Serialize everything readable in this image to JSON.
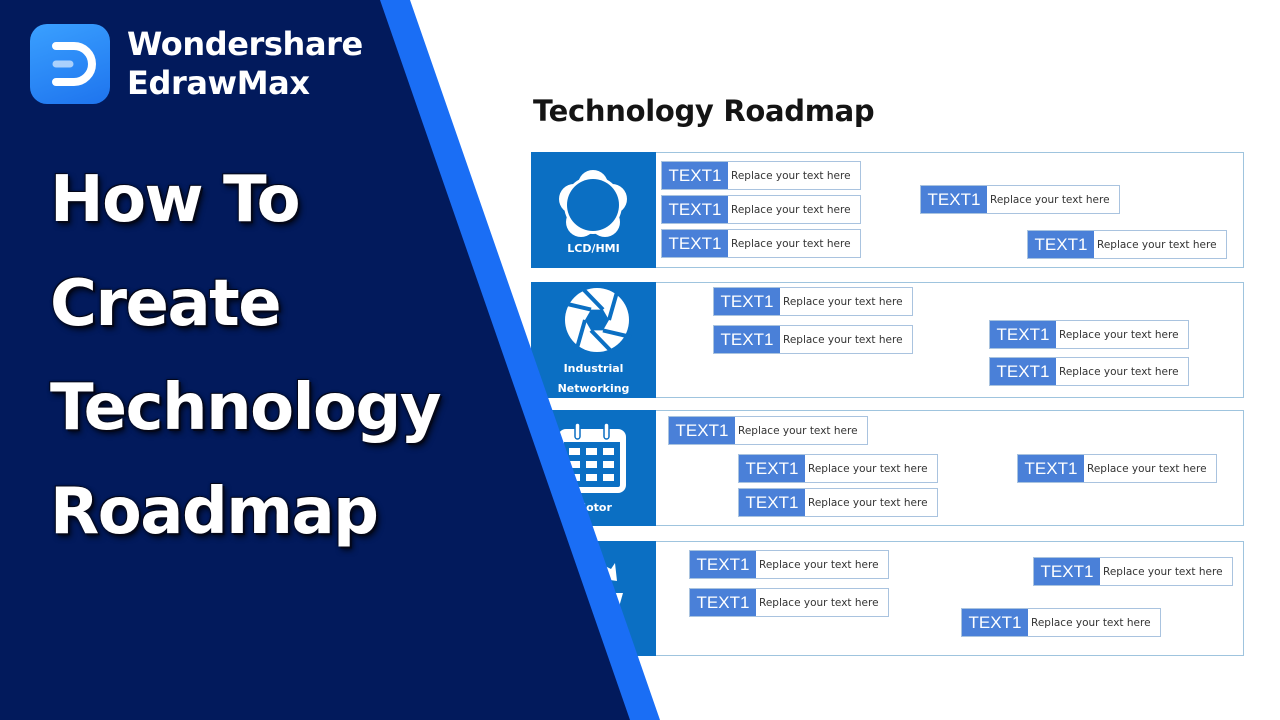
{
  "brand": {
    "name_line1": "Wondershare",
    "name_line2": "EdrawMax",
    "logo_icon": "edrawmax-logo-icon"
  },
  "headline": {
    "lines": [
      "How To",
      "Create",
      "Technology",
      "Roadmap"
    ]
  },
  "colors": {
    "navy_panel": "#021a5c",
    "accent_stripe": "#1a6ef5",
    "category_blue": "#0b6fc3",
    "tag_blue": "#4a80d8",
    "card_border": "#9fc4de"
  },
  "diagram": {
    "title": "Technology Roadmap",
    "rows": [
      {
        "category_lines": [
          "LCD/HMI"
        ],
        "icon": "flower-circle-icon",
        "items": [
          {
            "tag": "TEXT1",
            "text": "Replace your text here"
          },
          {
            "tag": "TEXT1",
            "text": "Replace your text here"
          },
          {
            "tag": "TEXT1",
            "text": "Replace your text here"
          },
          {
            "tag": "TEXT1",
            "text": "Replace your text here"
          },
          {
            "tag": "TEXT1",
            "text": "Replace your text here"
          }
        ]
      },
      {
        "category_lines": [
          "Industrial",
          "Networking"
        ],
        "icon": "aperture-icon",
        "items": [
          {
            "tag": "TEXT1",
            "text": "Replace your text here"
          },
          {
            "tag": "TEXT1",
            "text": "Replace your text here"
          },
          {
            "tag": "TEXT1",
            "text": "Replace your text here"
          },
          {
            "tag": "TEXT1",
            "text": "Replace your text here"
          }
        ]
      },
      {
        "category_lines": [
          "Motor"
        ],
        "icon": "calendar-icon",
        "items": [
          {
            "tag": "TEXT1",
            "text": "Replace your text here"
          },
          {
            "tag": "TEXT1",
            "text": "Replace your text here"
          },
          {
            "tag": "TEXT1",
            "text": "Replace your text here"
          },
          {
            "tag": "TEXT1",
            "text": "Replace your text here"
          }
        ]
      },
      {
        "category_lines": [],
        "icon": "arrows-icon",
        "items": [
          {
            "tag": "TEXT1",
            "text": "Replace your text here"
          },
          {
            "tag": "TEXT1",
            "text": "Replace your text here"
          },
          {
            "tag": "TEXT1",
            "text": "Replace your text here"
          },
          {
            "tag": "TEXT1",
            "text": "Replace your text here"
          }
        ]
      }
    ]
  }
}
